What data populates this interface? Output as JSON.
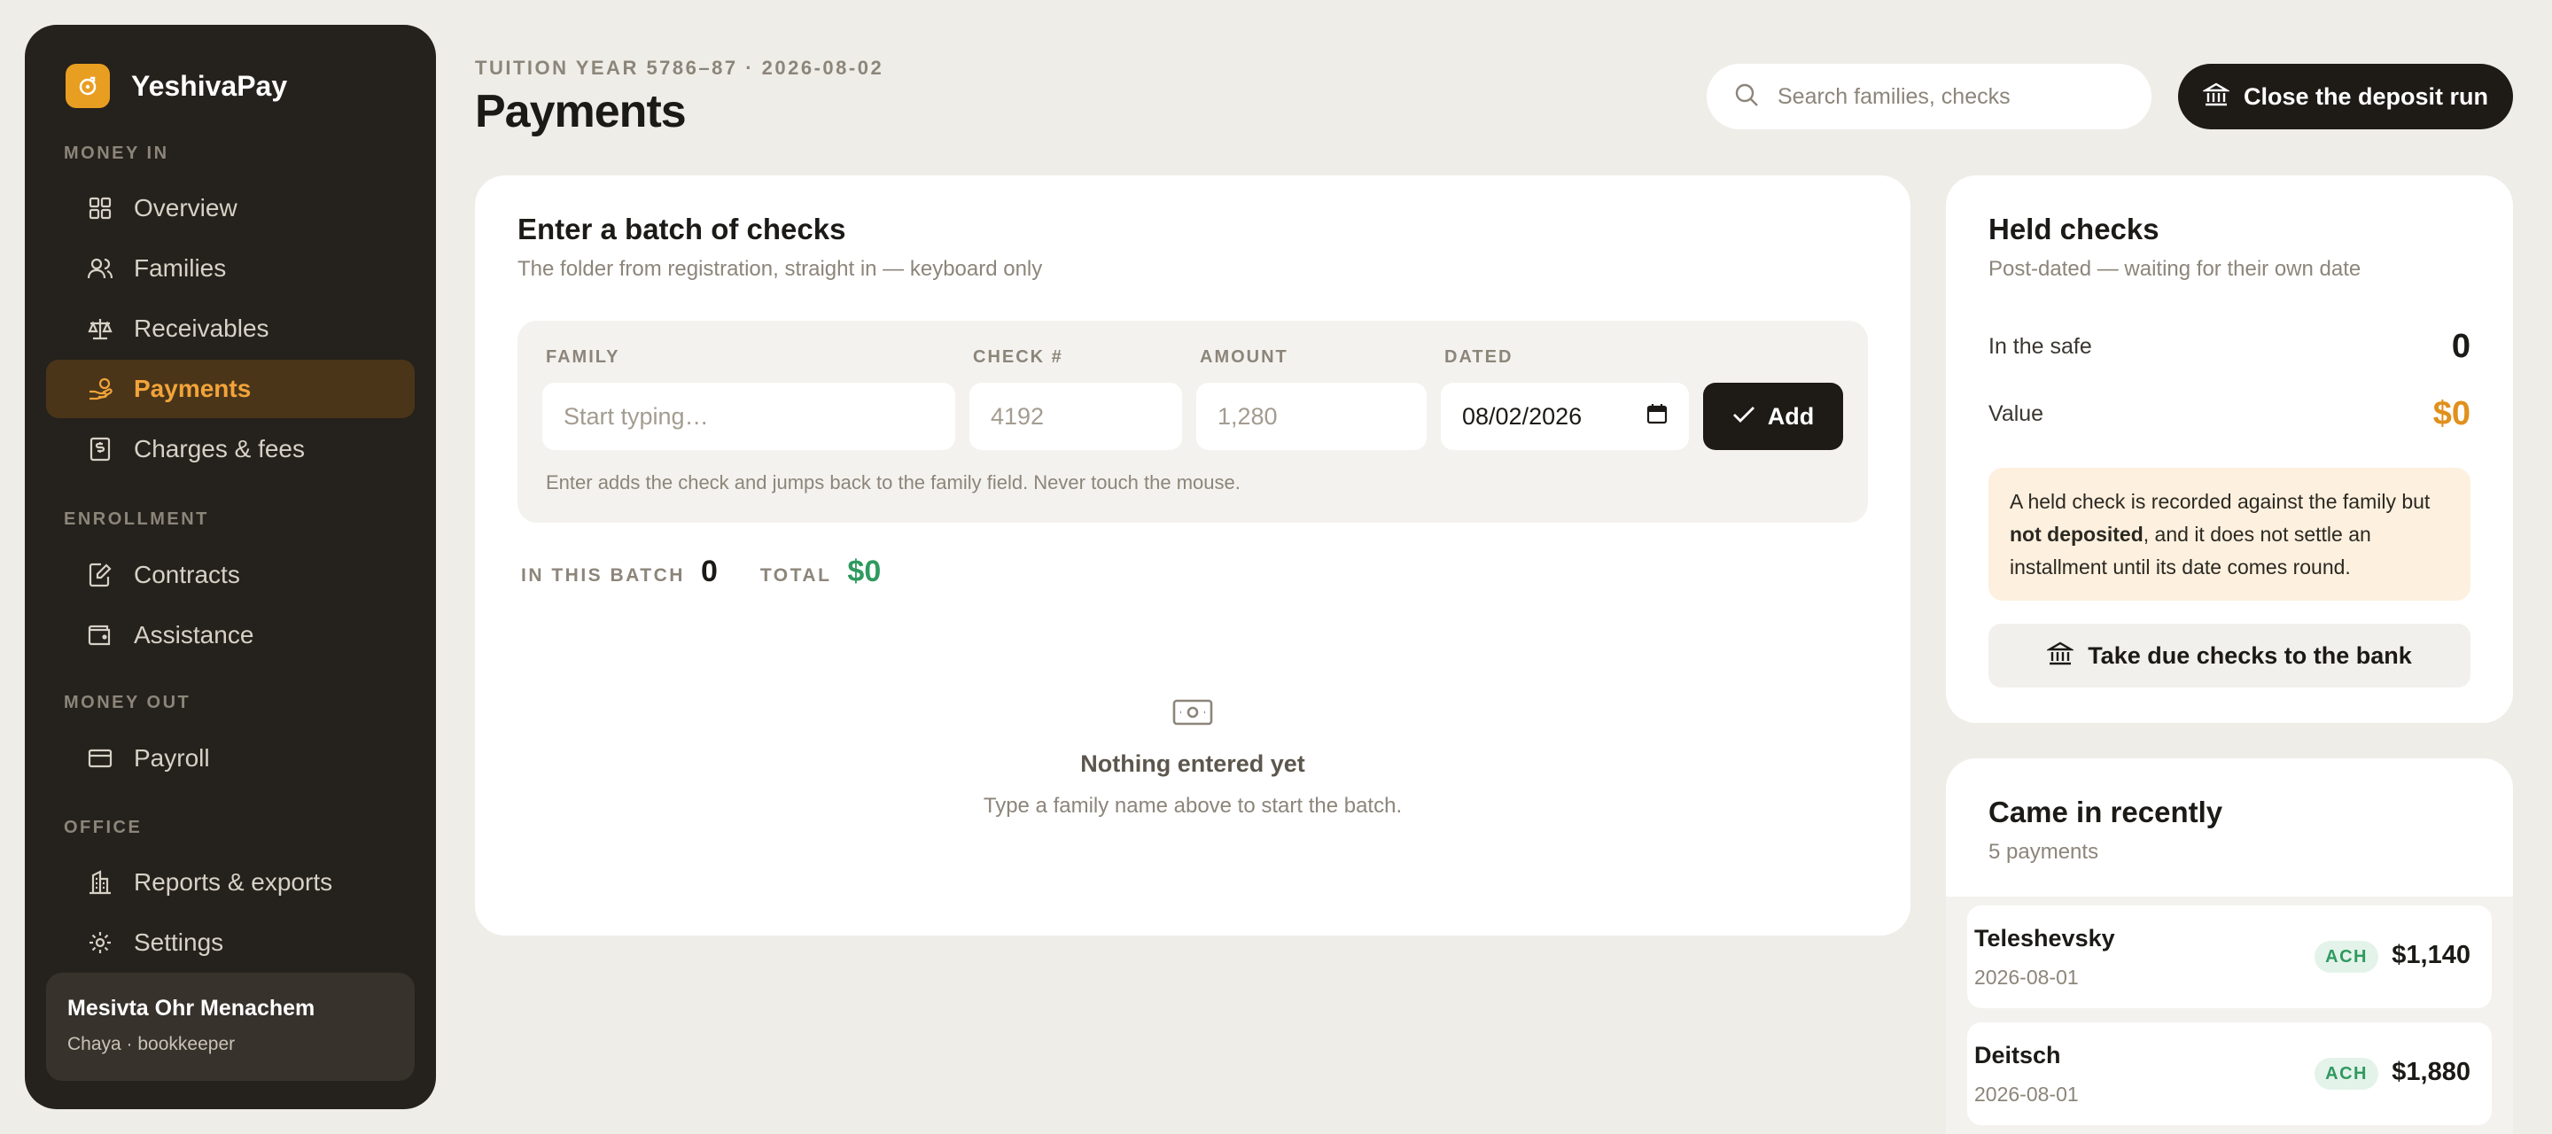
{
  "brand": {
    "name": "YeshivaPay"
  },
  "colors": {
    "accent": "#e89e21",
    "active_nav": "#f2a43a",
    "positive": "#2f9a5f",
    "sidebar_bg": "#25211c"
  },
  "sidebar": {
    "sections": [
      {
        "label": "MONEY IN",
        "items": [
          {
            "label": "Overview",
            "icon": "grid-icon"
          },
          {
            "label": "Families",
            "icon": "users-icon"
          },
          {
            "label": "Receivables",
            "icon": "scale-icon"
          },
          {
            "label": "Payments",
            "icon": "hand-coins-icon",
            "active": true
          },
          {
            "label": "Charges & fees",
            "icon": "receipt-icon"
          }
        ]
      },
      {
        "label": "ENROLLMENT",
        "items": [
          {
            "label": "Contracts",
            "icon": "file-pen-icon"
          },
          {
            "label": "Assistance",
            "icon": "wallet-icon"
          }
        ]
      },
      {
        "label": "MONEY OUT",
        "items": [
          {
            "label": "Payroll",
            "icon": "card-icon"
          }
        ]
      },
      {
        "label": "OFFICE",
        "items": [
          {
            "label": "Reports & exports",
            "icon": "building-icon"
          },
          {
            "label": "Settings",
            "icon": "gear-icon"
          }
        ]
      }
    ],
    "account": {
      "name": "Mesivta Ohr Menachem",
      "role": "Chaya · bookkeeper"
    }
  },
  "header": {
    "eyebrow": "TUITION YEAR 5786–87 · 2026-08-02",
    "title": "Payments",
    "search_placeholder": "Search families, checks",
    "primary_action": "Close the deposit run"
  },
  "batch": {
    "title": "Enter a batch of checks",
    "subtitle": "The folder from registration, straight in — keyboard only",
    "fields": {
      "family": {
        "label": "FAMILY",
        "placeholder": "Start typing…"
      },
      "check": {
        "label": "CHECK #",
        "placeholder": "4192"
      },
      "amount": {
        "label": "AMOUNT",
        "placeholder": "1,280"
      },
      "dated": {
        "label": "DATED",
        "value": "08/02/2026"
      }
    },
    "add_label": "Add",
    "hint": "Enter adds the check and jumps back to the family field. Never touch the mouse.",
    "count_label": "IN THIS BATCH",
    "count": "0",
    "total_label": "TOTAL",
    "total": "$0",
    "empty_title": "Nothing entered yet",
    "empty_sub": "Type a family name above to start the batch."
  },
  "held": {
    "title": "Held checks",
    "subtitle": "Post-dated — waiting for their own date",
    "in_safe_label": "In the safe",
    "in_safe": "0",
    "value_label": "Value",
    "value": "$0",
    "note_pre": "A held check is recorded against the family but ",
    "note_bold": "not deposited",
    "note_post": ", and it does not settle an installment until its date comes round.",
    "action": "Take due checks to the bank"
  },
  "recent": {
    "title": "Came in recently",
    "subtitle": "5 payments",
    "items": [
      {
        "name": "Teleshevsky",
        "date": "2026-08-01",
        "method": "ACH",
        "amount": "$1,140"
      },
      {
        "name": "Deitsch",
        "date": "2026-08-01",
        "method": "ACH",
        "amount": "$1,880"
      }
    ]
  }
}
